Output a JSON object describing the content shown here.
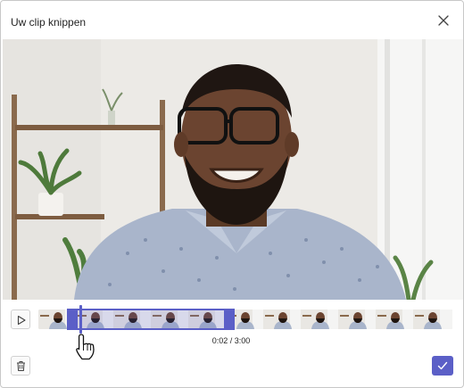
{
  "dialog": {
    "title": "Uw clip knippen"
  },
  "icons": {
    "close": "close-icon",
    "play": "play-icon",
    "delete": "trash-icon",
    "confirm": "checkmark-icon"
  },
  "player": {
    "time_readout": "0:02 / 3:00",
    "current_time_seconds": 2,
    "total_time_seconds": 180
  },
  "colors": {
    "accent": "#5b5fc7",
    "dialog_border": "#c8c8c8",
    "text": "#242424"
  }
}
